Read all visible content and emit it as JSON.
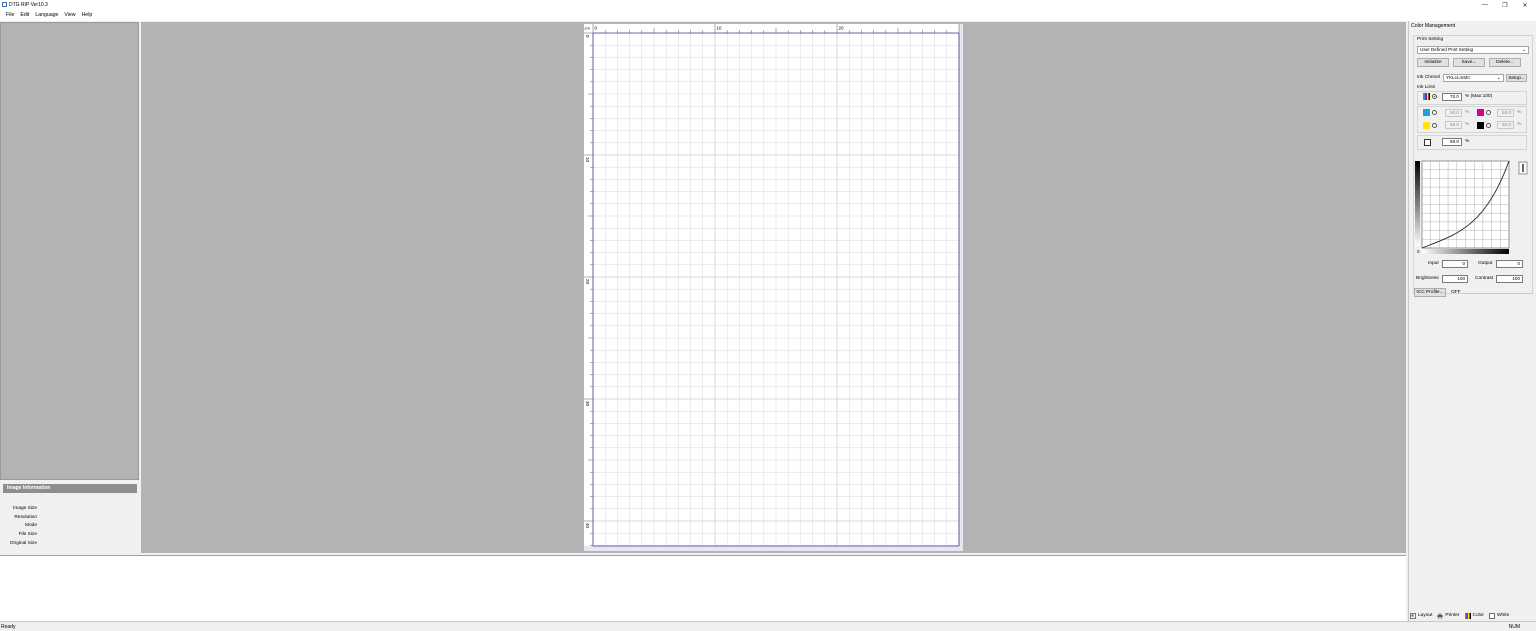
{
  "window": {
    "title": "DTG RIP Ver10.3",
    "minimize": "—",
    "restore": "❐",
    "close": "✕"
  },
  "menu": [
    "File",
    "Edit",
    "Language",
    "View",
    "Help"
  ],
  "image_info": {
    "header": "Image Information",
    "rows": [
      "Image Size",
      "Resolution",
      "Mode",
      "File Size",
      "Original Size"
    ]
  },
  "ruler": {
    "unit": "cm",
    "h_labels": [
      "0",
      "10",
      "20"
    ],
    "v_labels": [
      "0",
      "10",
      "20",
      "30",
      "40"
    ]
  },
  "color_management": {
    "title": "Color Management",
    "print_setting_label": "Print Setting",
    "print_setting_value": "User Defined Print Setting",
    "initialize": "Initialize",
    "save": "Save...",
    "delete": "Delete...",
    "ink_channel_label": "Ink Chnnel",
    "ink_channel_value": "YKLcLmMC",
    "setup": "Setup...",
    "ink_limit_label": "Ink Limit",
    "ink_limit_value": "70.0",
    "ink_limit_unit": "% (Max:100)",
    "cyan_value": "50.0",
    "magenta_value": "50.0",
    "yellow_value": "50.0",
    "black_value": "50.0",
    "percent": "%",
    "white_value": "90.0",
    "curve_zero": "0",
    "input_label": "Input",
    "input_value": "0",
    "output_label": "Output",
    "output_value": "0",
    "brightness_label": "Brightness",
    "brightness_value": "100",
    "contrast_label": "Contrast",
    "contrast_value": "100",
    "icc_button": "ICC Profile...",
    "icc_status": "OFF"
  },
  "tabs": [
    "Layout",
    "Printer",
    "Color",
    "White"
  ],
  "status": {
    "text": "Ready",
    "num": "NUM"
  },
  "colors": {
    "cyan": "#1aa3d9",
    "magenta": "#d6008f",
    "yellow": "#ffe600",
    "black": "#000000",
    "canvas_bg": "#b3b3b3",
    "grid_line": "#d9d9d9",
    "ruler_line": "#3c3c8c"
  }
}
